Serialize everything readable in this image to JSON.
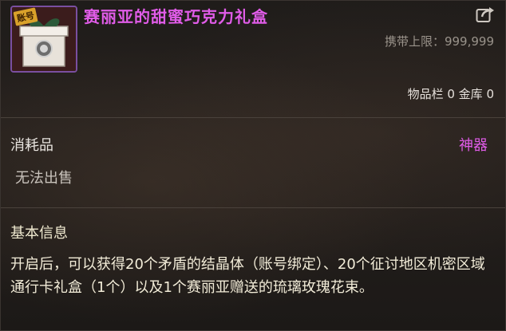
{
  "item": {
    "name": "赛丽亚的甜蜜巧克力礼盒",
    "badge": "账号",
    "carry_limit": "携带上限：999,999",
    "inventory": "物品栏 0 金库 0",
    "category": "消耗品",
    "rarity": "神器",
    "sell_status": "无法出售"
  },
  "info": {
    "title": "基本信息",
    "description": "开启后，可以获得20个矛盾的结晶体（账号绑定）、20个征讨地区机密区域通行卡礼盒（1个）以及1个赛丽亚赠送的琉璃玫瑰花束。"
  },
  "colors": {
    "name": "#e05ce8",
    "rarity": "#e05ce8",
    "icon_border": "#7a4fa0"
  },
  "icons": [
    "gift-box-icon",
    "share-icon"
  ]
}
